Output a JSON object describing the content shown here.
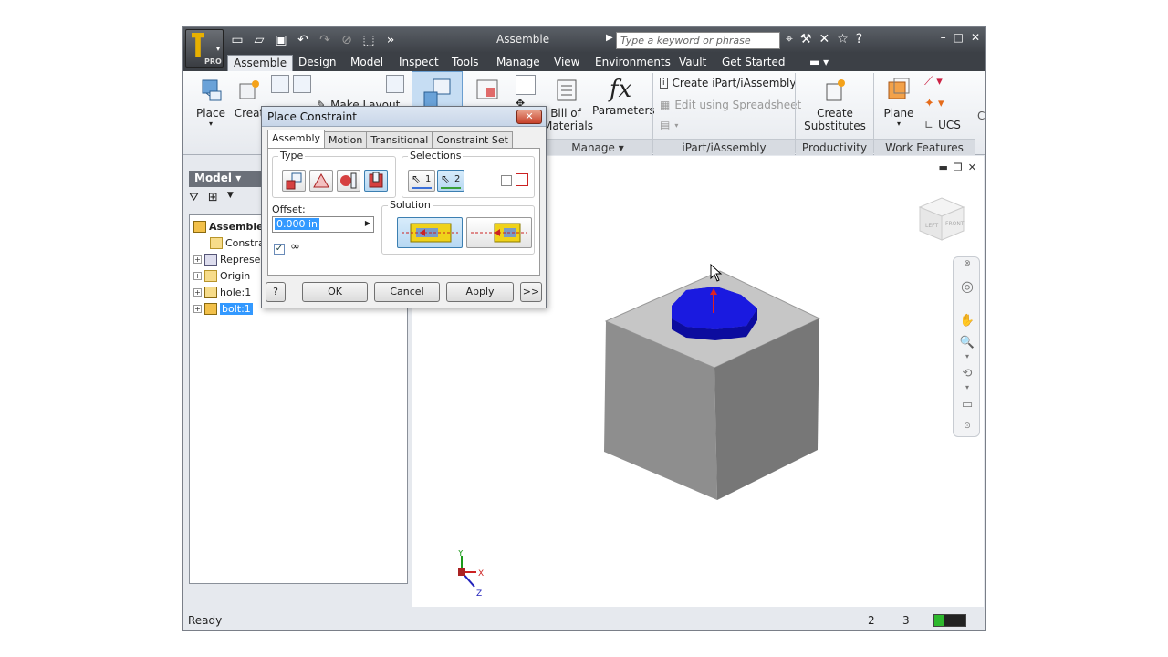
{
  "window": {
    "title": "Assemble",
    "search_placeholder": "Type a keyword or phrase",
    "app_badge": "PRO"
  },
  "tabs": [
    "Assemble",
    "Design",
    "Model",
    "Inspect",
    "Tools",
    "Manage",
    "View",
    "Environments",
    "Vault",
    "Get Started"
  ],
  "ribbon": {
    "place": "Place",
    "create": "Creat",
    "make_layout": "Make Layout",
    "bom_line1": "Bill of",
    "bom_line2": "Materials",
    "parameters": "Parameters",
    "fx": "fx",
    "create_ipart": "Create iPart/iAssembly",
    "edit_spreadsheet": "Edit using Spreadsheet",
    "create_substitutes_1": "Create",
    "create_substitutes_2": "Substitutes",
    "plane": "Plane",
    "ucs": "UCS",
    "c_cut": "C",
    "panel_manage": "Manage ▾",
    "panel_ipart": "iPart/iAssembly",
    "panel_productivity": "Productivity",
    "panel_work_features": "Work Features"
  },
  "browser": {
    "header": "Model ▾",
    "items": [
      {
        "label": "Assemble",
        "bold": true
      },
      {
        "label": "Constra"
      },
      {
        "label": "Represe"
      },
      {
        "label": "Origin"
      },
      {
        "label": "hole:1"
      },
      {
        "label": "bolt:1"
      }
    ]
  },
  "dialog": {
    "title": "Place Constraint",
    "close": "✕",
    "tabs": [
      "Assembly",
      "Motion",
      "Transitional",
      "Constraint Set"
    ],
    "type_label": "Type",
    "selections_label": "Selections",
    "sel1": "1",
    "sel2": "2",
    "offset_label": "Offset:",
    "offset_value": "0.000 in",
    "solution_label": "Solution",
    "help": "?",
    "ok": "OK",
    "cancel": "Cancel",
    "apply": "Apply",
    "more": ">>"
  },
  "viewcube": {
    "left": "LEFT",
    "front": "FRONT"
  },
  "triad": {
    "x": "X",
    "y": "Y",
    "z": "Z"
  },
  "status": {
    "text": "Ready",
    "num1": "2",
    "num2": "3"
  }
}
